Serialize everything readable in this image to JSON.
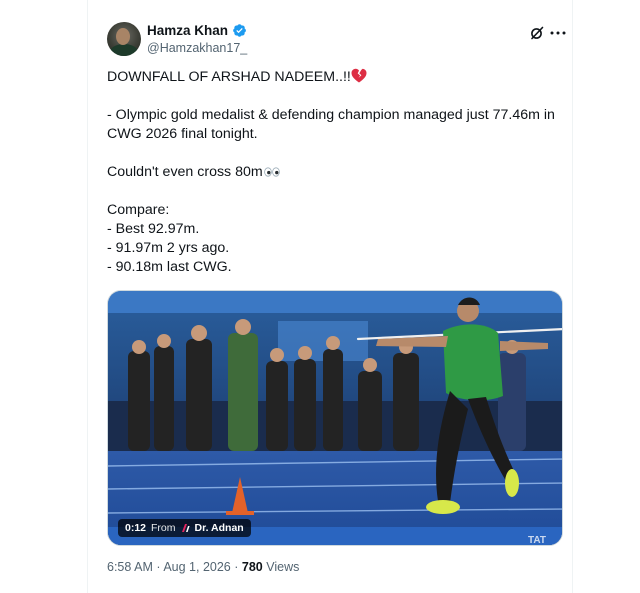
{
  "author": {
    "display_name": "Hamza Khan",
    "handle": "@Hamzakhan17_",
    "verified": true
  },
  "tweet": {
    "lines": [
      "DOWNFALL OF ARSHAD NADEEM..!!",
      "- Olympic gold medalist & defending champion managed just 77.46m in CWG 2026 final tonight.",
      "Couldn't even cross 80m",
      "Compare:",
      "- Best 92.97m.",
      "- 91.97m 2 yrs ago.",
      "- 90.18m last CWG."
    ],
    "emojis": {
      "line1": "broken-heart",
      "line3": "eyes"
    }
  },
  "media": {
    "duration": "0:12",
    "from_label": "From",
    "source_name": "Dr. Adnan",
    "watermark": "TAT"
  },
  "meta": {
    "time": "6:58 AM",
    "separator": "·",
    "date": "Aug 1, 2026",
    "views_count": "780",
    "views_label": "Views"
  },
  "icons": {
    "grok": "grok-icon",
    "more": "more-icon",
    "verified": "verified-badge-icon"
  },
  "colors": {
    "verified_blue": "#1d9bf0",
    "text": "#0f1419",
    "secondary": "#536471",
    "border": "#cfd9de"
  }
}
